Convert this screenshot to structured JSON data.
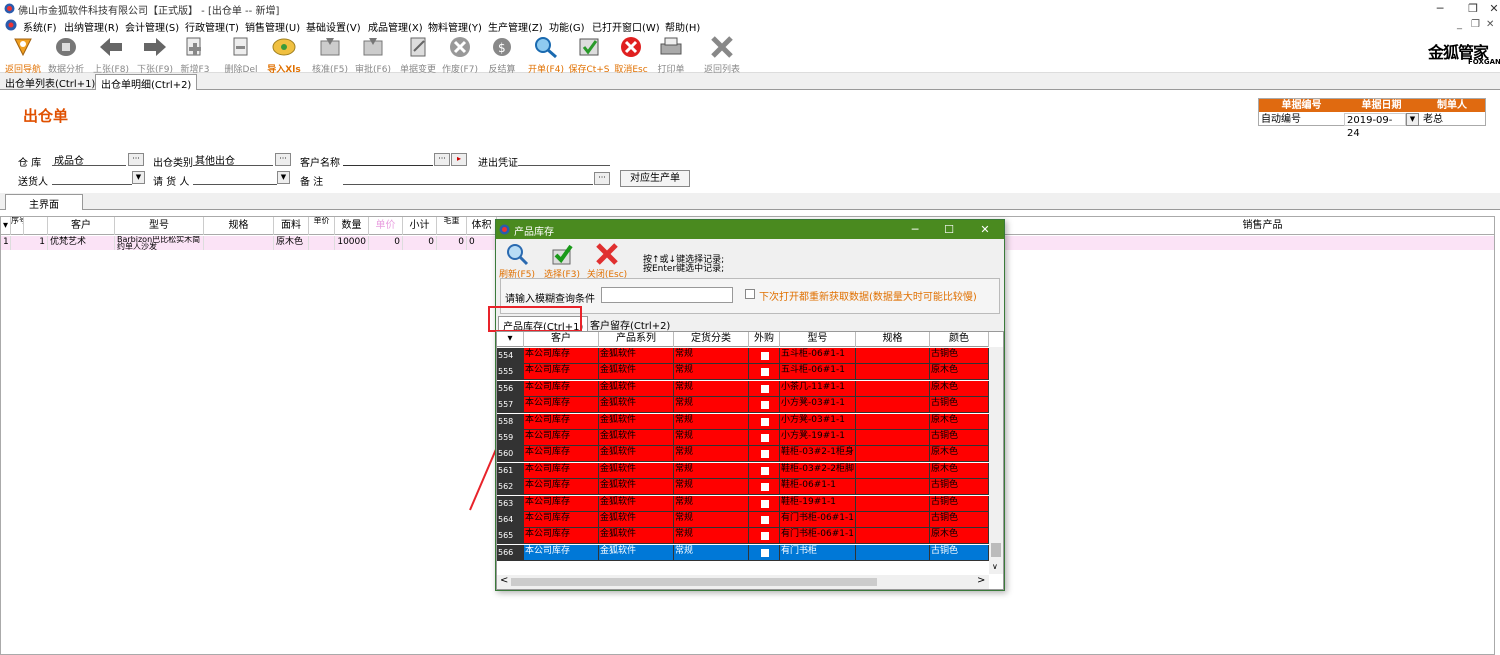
{
  "window": {
    "title": "佛山市金狐软件科技有限公司【正式版】 - [出仓单 -- 新增]",
    "controls": [
      "─",
      "❐",
      "✕"
    ]
  },
  "menu": [
    "系统(F)",
    "出纳管理(R)",
    "会计管理(S)",
    "行政管理(T)",
    "销售管理(U)",
    "基础设置(V)",
    "成品管理(X)",
    "物料管理(Y)",
    "生产管理(Z)",
    "功能(G)",
    "已打开窗口(W)",
    "帮助(H)"
  ],
  "mdi_controls": [
    "_",
    "❐",
    "✕"
  ],
  "toolbar": [
    {
      "label": "返回导航",
      "icon": "return-nav-icon",
      "active": true
    },
    {
      "label": "数据分析",
      "icon": "data-analysis-icon",
      "active": false
    },
    {
      "label": "上张(F8)",
      "icon": "prev-icon",
      "active": false
    },
    {
      "label": "下张(F9)",
      "icon": "next-icon",
      "active": false
    },
    {
      "label": "新增F3",
      "icon": "new-icon",
      "active": false
    },
    {
      "label": "删除Del",
      "icon": "delete-icon",
      "active": false
    },
    {
      "label": "导入Xls",
      "icon": "import-xls-icon",
      "active": true
    },
    {
      "label": "核准(F5)",
      "icon": "approve-icon",
      "active": false
    },
    {
      "label": "审批(F6)",
      "icon": "review-icon",
      "active": false
    },
    {
      "label": "单据变更",
      "icon": "change-icon",
      "active": false
    },
    {
      "label": "作废(F7)",
      "icon": "void-icon",
      "active": false
    },
    {
      "label": "反结算",
      "icon": "unsettle-icon",
      "active": false
    },
    {
      "label": "开单(F4)",
      "icon": "open-bill-icon",
      "active": true
    },
    {
      "label": "保存Ct+S",
      "icon": "save-icon",
      "active": true
    },
    {
      "label": "取消Esc",
      "icon": "cancel-icon",
      "active": true
    },
    {
      "label": "打印单",
      "icon": "print-icon",
      "active": false
    },
    {
      "label": "返回列表",
      "icon": "return-list-icon",
      "active": false
    }
  ],
  "logo": {
    "text": "金狐管家",
    "sub": "FOXGAN"
  },
  "tabs": [
    "出仓单列表(Ctrl+1)",
    "出仓单明细(Ctrl+2)"
  ],
  "form": {
    "title": "出仓单",
    "warehouse_label": "仓  库",
    "warehouse_value": "成品仓",
    "out_type_label": "出仓类别",
    "out_type_value": "其他出仓",
    "customer_label": "客户名称",
    "customer_value": "",
    "voucher_label": "进出凭证",
    "voucher_value": "",
    "sender_label": "送货人",
    "sender_value": "",
    "requester_label": "请 货 人",
    "requester_value": "",
    "remark_label": "备    注",
    "remark_value": "",
    "produce_button": "对应生产单",
    "bill_no_header": "单据编号",
    "bill_date_header": "单据日期",
    "maker_header": "制单人",
    "bill_no": "自动编号",
    "bill_date": "2019-09-24",
    "maker": "老总"
  },
  "subtab": "主界面",
  "grid": {
    "headers": [
      "序号",
      "客户",
      "型号",
      "规格",
      "面料",
      "单价",
      "数量",
      "单价",
      "小计",
      "毛重",
      "体积",
      "销售产品"
    ],
    "row": {
      "marker": "1",
      "seq": "1",
      "customer": "优梵艺术",
      "model": "Barbizon巴比松实木简约单人沙发",
      "fabric": "原木色",
      "qty": "10000",
      "price": "0",
      "subtotal": "0",
      "weight": "0",
      "volume": "0"
    }
  },
  "dialog": {
    "title": "产品库存",
    "toolbar": [
      {
        "label": "刷新(F5)",
        "icon": "refresh-search-icon"
      },
      {
        "label": "选择(F3)",
        "icon": "select-check-icon"
      },
      {
        "label": "关闭(Esc)",
        "icon": "close-x-icon"
      }
    ],
    "hint_line1": "按↑或↓键选择记录;",
    "hint_line2": "按Enter键选中记录;",
    "search_label": "请输入模糊查询条件",
    "search_value": "",
    "checkbox_label": "下次打开都重新获取数据(数据量大时可能比较慢)",
    "tabs": [
      "产品库存(Ctrl+1)",
      "客户留存(Ctrl+2)"
    ],
    "headers": [
      "",
      "客户",
      "产品系列",
      "定货分类",
      "外购",
      "型号",
      "规格",
      "颜色"
    ],
    "rows": [
      {
        "no": "554",
        "customer": "本公司库存",
        "series": "金狐软件",
        "cat": "常规",
        "model": "五斗柜-06#1-1",
        "spec": "",
        "color": "古铜色"
      },
      {
        "no": "555",
        "customer": "本公司库存",
        "series": "金狐软件",
        "cat": "常规",
        "model": "五斗柜-06#1-1",
        "spec": "",
        "color": "原木色"
      },
      {
        "no": "556",
        "customer": "本公司库存",
        "series": "金狐软件",
        "cat": "常规",
        "model": "小茶几-11#1-1",
        "spec": "",
        "color": "原木色"
      },
      {
        "no": "557",
        "customer": "本公司库存",
        "series": "金狐软件",
        "cat": "常规",
        "model": "小方凳-03#1-1",
        "spec": "",
        "color": "古铜色"
      },
      {
        "no": "558",
        "customer": "本公司库存",
        "series": "金狐软件",
        "cat": "常规",
        "model": "小方凳-03#1-1",
        "spec": "",
        "color": "原木色"
      },
      {
        "no": "559",
        "customer": "本公司库存",
        "series": "金狐软件",
        "cat": "常规",
        "model": "小方凳-19#1-1",
        "spec": "",
        "color": "古铜色"
      },
      {
        "no": "560",
        "customer": "本公司库存",
        "series": "金狐软件",
        "cat": "常规",
        "model": "鞋柜-03#2-1柜身",
        "spec": "",
        "color": "原木色"
      },
      {
        "no": "561",
        "customer": "本公司库存",
        "series": "金狐软件",
        "cat": "常规",
        "model": "鞋柜-03#2-2柜脚",
        "spec": "",
        "color": "原木色"
      },
      {
        "no": "562",
        "customer": "本公司库存",
        "series": "金狐软件",
        "cat": "常规",
        "model": "鞋柜-06#1-1",
        "spec": "",
        "color": "古铜色"
      },
      {
        "no": "563",
        "customer": "本公司库存",
        "series": "金狐软件",
        "cat": "常规",
        "model": "鞋柜-19#1-1",
        "spec": "",
        "color": "古铜色"
      },
      {
        "no": "564",
        "customer": "本公司库存",
        "series": "金狐软件",
        "cat": "常规",
        "model": "有门书柜-06#1-1",
        "spec": "",
        "color": "古铜色"
      },
      {
        "no": "565",
        "customer": "本公司库存",
        "series": "金狐软件",
        "cat": "常规",
        "model": "有门书柜-06#1-1",
        "spec": "",
        "color": "原木色"
      },
      {
        "no": "566",
        "customer": "本公司库存",
        "series": "金狐软件",
        "cat": "常规",
        "model": "有门书柜",
        "spec": "",
        "color": "古铜色"
      }
    ],
    "colors": {
      "row_red": "#ff0000",
      "row_selected": "#0078d7",
      "title_bar": "#4a8a1f"
    }
  }
}
